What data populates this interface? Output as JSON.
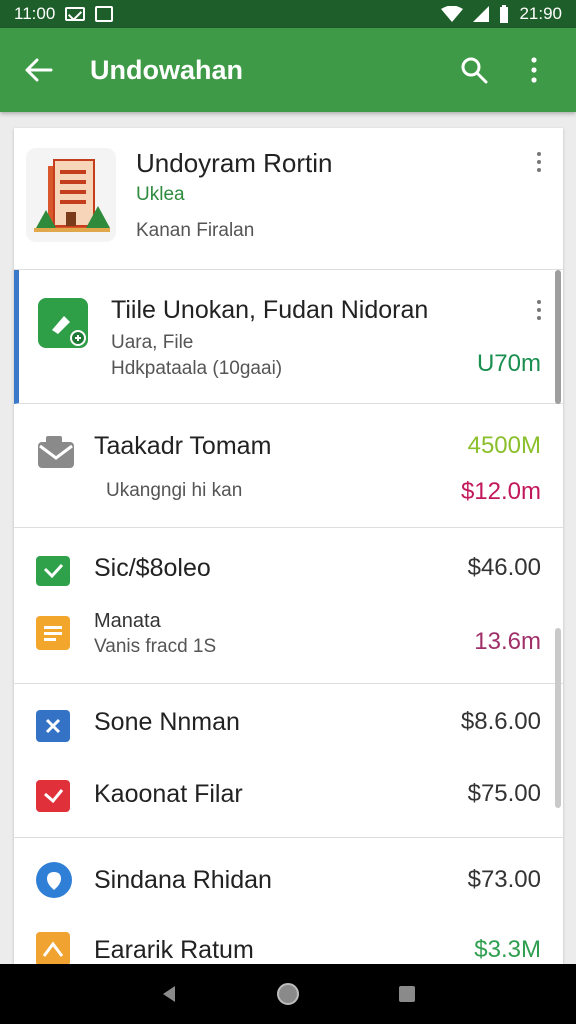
{
  "status_bar": {
    "time": "11:00",
    "battery": "21:90"
  },
  "app_bar": {
    "title": "Undowahan"
  },
  "header_item": {
    "name": "Undoyram Rortin",
    "category": "Uklea",
    "location": "Kanan Firalan"
  },
  "items": [
    {
      "name": "Tiile Unokan, Fudan Nidoran",
      "sub1": "Uara, File",
      "sub2": "Hdkpataala (10gaai)",
      "amount": "U70m",
      "amount_color": "#1a8f4f"
    },
    {
      "name": "Taakadr Tomam",
      "sub1": "Ukangngi hi kan",
      "amount_top": "4500M",
      "amount_top_color": "#8bbf2c",
      "amount": "$12.0m",
      "amount_color": "#c2185b"
    },
    {
      "name": "Sic/$8oleo",
      "amount": "$46.00",
      "amount_color": "#333333"
    },
    {
      "name": "Manata",
      "sub1": "Vanis fracd 1S",
      "amount": "13.6m",
      "amount_color": "#a0306a"
    },
    {
      "name": "Sone Nnman",
      "amount": "$8.6.00",
      "amount_color": "#333333"
    },
    {
      "name": "Kaoonat Filar",
      "amount": "$75.00",
      "amount_color": "#333333"
    },
    {
      "name": "Sindana Rhidan",
      "amount": "$73.00",
      "amount_color": "#333333"
    },
    {
      "name": "Eararik Ratum",
      "amount": "$3.3M",
      "amount_color": "#2e9e4f"
    }
  ],
  "colors": {
    "app_bar": "#3e9a46",
    "status_bar": "#1e5e2a",
    "accent_left": "#3a78c9"
  }
}
